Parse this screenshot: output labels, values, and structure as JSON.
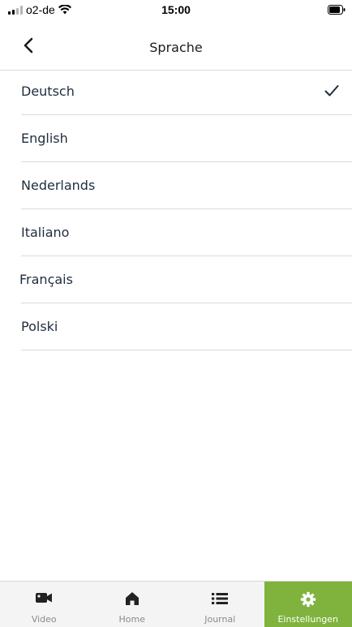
{
  "status_bar": {
    "carrier": "o2-de",
    "time": "15:00"
  },
  "header": {
    "title": "Sprache"
  },
  "languages": [
    {
      "label": "Deutsch",
      "selected": true
    },
    {
      "label": "English",
      "selected": false
    },
    {
      "label": "Nederlands",
      "selected": false
    },
    {
      "label": "Italiano",
      "selected": false
    },
    {
      "label": "Français",
      "selected": false
    },
    {
      "label": "Polski",
      "selected": false
    }
  ],
  "tabbar": {
    "tabs": [
      {
        "label": "Video",
        "icon": "video-camera-icon"
      },
      {
        "label": "Home",
        "icon": "home-icon"
      },
      {
        "label": "Journal",
        "icon": "list-icon"
      },
      {
        "label": "Einstellungen",
        "icon": "gear-icon",
        "active": true
      }
    ],
    "active_color": "#7fb33d"
  }
}
